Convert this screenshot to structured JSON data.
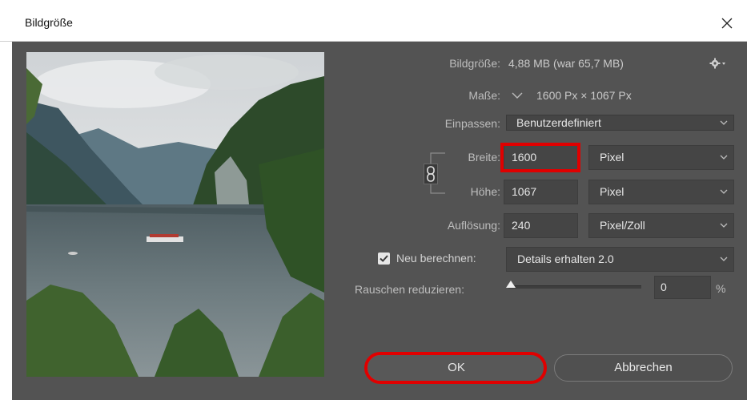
{
  "window": {
    "title": "Bildgröße"
  },
  "info": {
    "size_label": "Bildgröße:",
    "size_value": "4,88 MB (war 65,7 MB)",
    "dims_label": "Maße:",
    "dims_value": "1600 Px  ×  1067 Px"
  },
  "fit": {
    "label": "Einpassen:",
    "value": "Benutzerdefiniert"
  },
  "width": {
    "label": "Breite:",
    "value": "1600",
    "unit": "Pixel"
  },
  "height": {
    "label": "Höhe:",
    "value": "1067",
    "unit": "Pixel"
  },
  "resolution": {
    "label": "Auflösung:",
    "value": "240",
    "unit": "Pixel/Zoll"
  },
  "resample": {
    "label": "Neu berechnen:",
    "checked": true,
    "value": "Details erhalten 2.0"
  },
  "noise": {
    "label": "Rauschen reduzieren:",
    "value": "0",
    "unit": "%",
    "level": 0
  },
  "buttons": {
    "ok": "OK",
    "cancel": "Abbrechen"
  },
  "colors": {
    "highlight": "#e00000",
    "dialog_bg": "#535353",
    "field_bg": "#454545"
  },
  "icons": [
    "close-icon",
    "gear-icon",
    "chevron-down-icon",
    "chain-link-icon",
    "checkbox-check-icon"
  ]
}
